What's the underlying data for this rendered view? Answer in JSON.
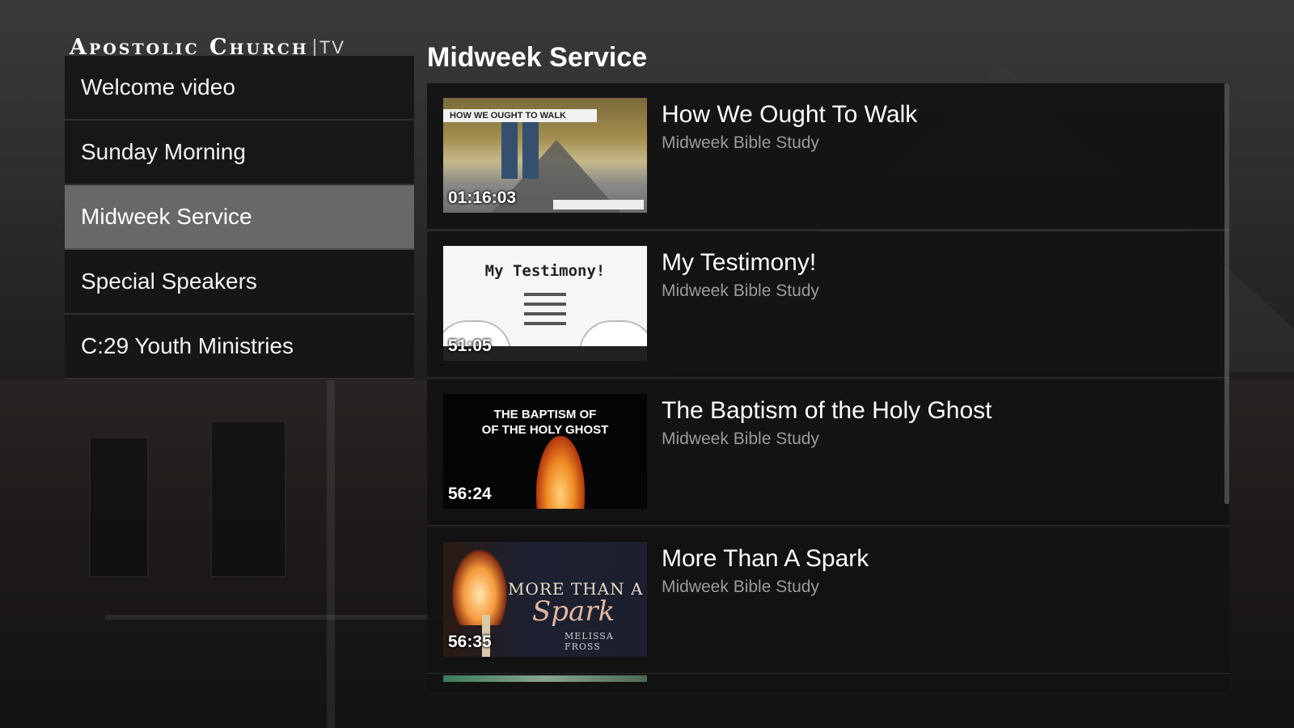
{
  "app": {
    "logo_main": "Apostolic Church",
    "logo_suffix": "TV"
  },
  "sidebar": {
    "items": [
      {
        "label": "Welcome video",
        "selected": false
      },
      {
        "label": "Sunday Morning",
        "selected": false
      },
      {
        "label": "Midweek Service",
        "selected": true
      },
      {
        "label": "Special Speakers",
        "selected": false
      },
      {
        "label": "C:29 Youth Ministries",
        "selected": false
      }
    ]
  },
  "main": {
    "section_title": "Midweek Service",
    "videos": [
      {
        "title": "How We Ought To Walk",
        "subtitle": "Midweek Bible Study",
        "duration": "01:16:03",
        "thumb_text": "HOW WE OUGHT TO WALK"
      },
      {
        "title": "My Testimony!",
        "subtitle": "Midweek Bible Study",
        "duration": "51:05",
        "thumb_text": "My Testimony!"
      },
      {
        "title": "The Baptism of the Holy Ghost",
        "subtitle": "Midweek Bible Study",
        "duration": "56:24",
        "thumb_text_line1": "THE BAPTISM OF",
        "thumb_text_line2": "OF THE HOLY GHOST"
      },
      {
        "title": "More Than A Spark",
        "subtitle": "Midweek Bible Study",
        "duration": "56:35",
        "thumb_text_line1": "MORE THAN A",
        "thumb_text_line2": "Spark",
        "thumb_text_line3": "MELISSA FROSS"
      }
    ]
  },
  "colors": {
    "selected_item_bg": "#737373",
    "panel_bg": "#161616",
    "subtitle_text": "#9a9a9a"
  }
}
